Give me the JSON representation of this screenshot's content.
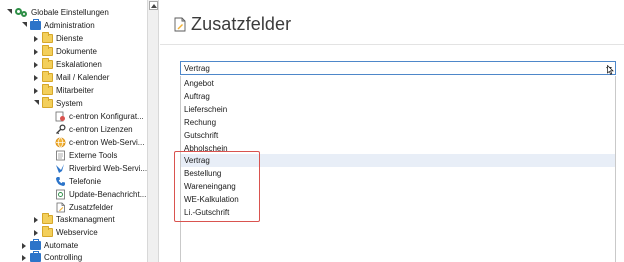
{
  "tree": {
    "items": [
      {
        "label": "Globale Einstellungen",
        "icon": "gears-icon"
      },
      {
        "label": "Administration",
        "icon": "briefcase-icon"
      },
      {
        "label": "Dienste",
        "icon": "folder-icon"
      },
      {
        "label": "Dokumente",
        "icon": "folder-icon"
      },
      {
        "label": "Eskalationen",
        "icon": "folder-icon"
      },
      {
        "label": "Mail / Kalender",
        "icon": "folder-icon"
      },
      {
        "label": "Mitarbeiter",
        "icon": "folder-icon"
      },
      {
        "label": "System",
        "icon": "folder-icon"
      },
      {
        "label": "c-entron Konfigurat...",
        "icon": "config-icon"
      },
      {
        "label": "c-entron Lizenzen",
        "icon": "key-icon"
      },
      {
        "label": "c-entron Web-Servi...",
        "icon": "globe-icon"
      },
      {
        "label": "Externe Tools",
        "icon": "tools-icon"
      },
      {
        "label": "Riverbird Web-Servi...",
        "icon": "bird-icon"
      },
      {
        "label": "Telefonie",
        "icon": "phone-icon"
      },
      {
        "label": "Update-Benachricht...",
        "icon": "update-icon"
      },
      {
        "label": "Zusatzfelder",
        "icon": "page-icon"
      },
      {
        "label": "Taskmanagment",
        "icon": "folder-icon"
      },
      {
        "label": "Webservice",
        "icon": "folder-icon"
      },
      {
        "label": "Automate",
        "icon": "briefcase-icon"
      },
      {
        "label": "Controlling",
        "icon": "briefcase-icon"
      }
    ]
  },
  "main": {
    "title": "Zusatzfelder",
    "dropdown": {
      "selected": "Vertrag",
      "options": [
        "Angebot",
        "Auftrag",
        "Lieferschein",
        "Rechung",
        "Gutschrift",
        "Abholschein",
        "Vertrag",
        "Bestellung",
        "Wareneingang",
        "WE-Kalkulation",
        "Li.-Gutschrift"
      ]
    }
  },
  "colors": {
    "accent": "#4e87c9",
    "highlight_box": "#d9534f",
    "folder": "#f3cf5b",
    "briefcase": "#2c74c9",
    "gear": "#2e8f47"
  }
}
